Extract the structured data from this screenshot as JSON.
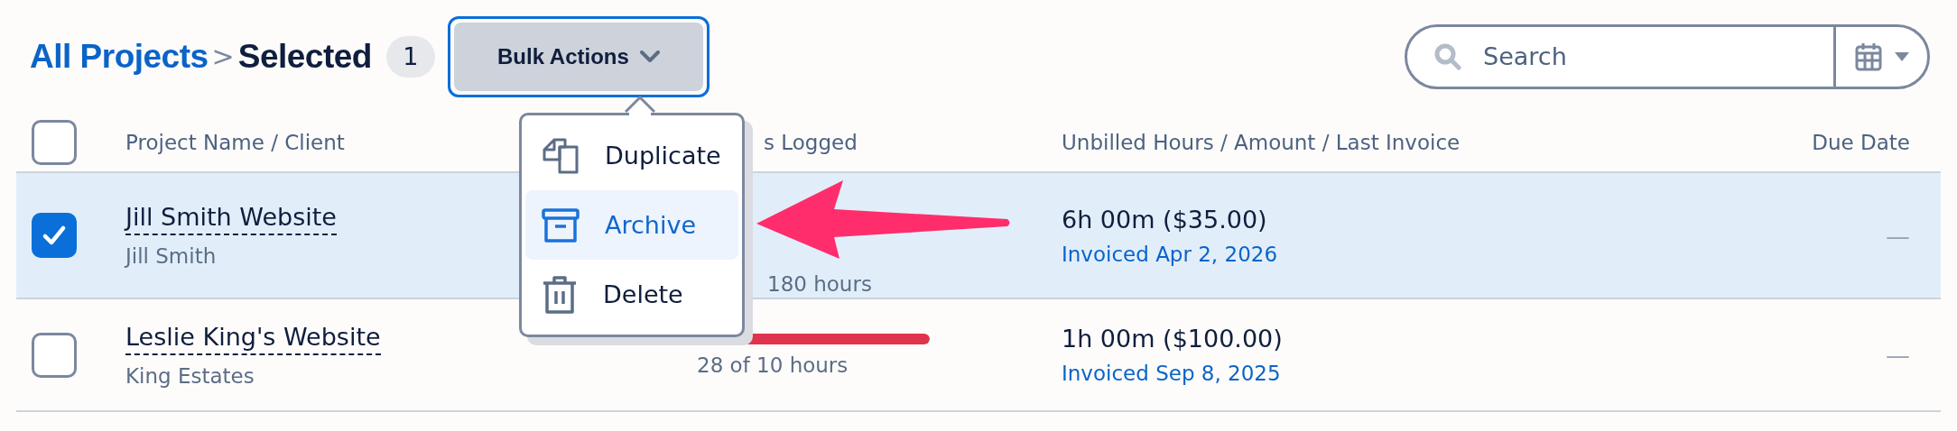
{
  "breadcrumb": {
    "parent": "All Projects",
    "separator": ">",
    "current": "Selected"
  },
  "selected_count": "1",
  "bulk_actions": {
    "label": "Bulk Actions",
    "focused": true
  },
  "search": {
    "placeholder": "Search"
  },
  "table": {
    "select_all": {
      "checked": false
    },
    "columns": [
      "Project Name / Client",
      "s Logged",
      "Unbilled Hours / Amount / Last Invoice",
      "Due Date"
    ],
    "rows": [
      {
        "selected": true,
        "name": "Jill Smith Website",
        "client": "Jill Smith",
        "hours": "180 hours",
        "unbilled": "6h 00m ($35.00)",
        "invoice": "Invoiced Apr 2, 2026",
        "due": "—"
      },
      {
        "selected": false,
        "name": "Leslie King's Website",
        "client": "King Estates",
        "progress": {
          "level": 1,
          "over": true
        },
        "hours": "28 of 10 hours",
        "unbilled": "1h 00m ($100.00)",
        "invoice": "Invoiced Sep 8, 2025",
        "due": "—"
      }
    ]
  },
  "menu": {
    "items": [
      {
        "kind": "duplicate",
        "label": "Duplicate",
        "selected": false
      },
      {
        "kind": "archive",
        "label": "Archive",
        "selected": true
      },
      {
        "kind": "delete",
        "label": "Delete",
        "selected": false
      }
    ]
  }
}
